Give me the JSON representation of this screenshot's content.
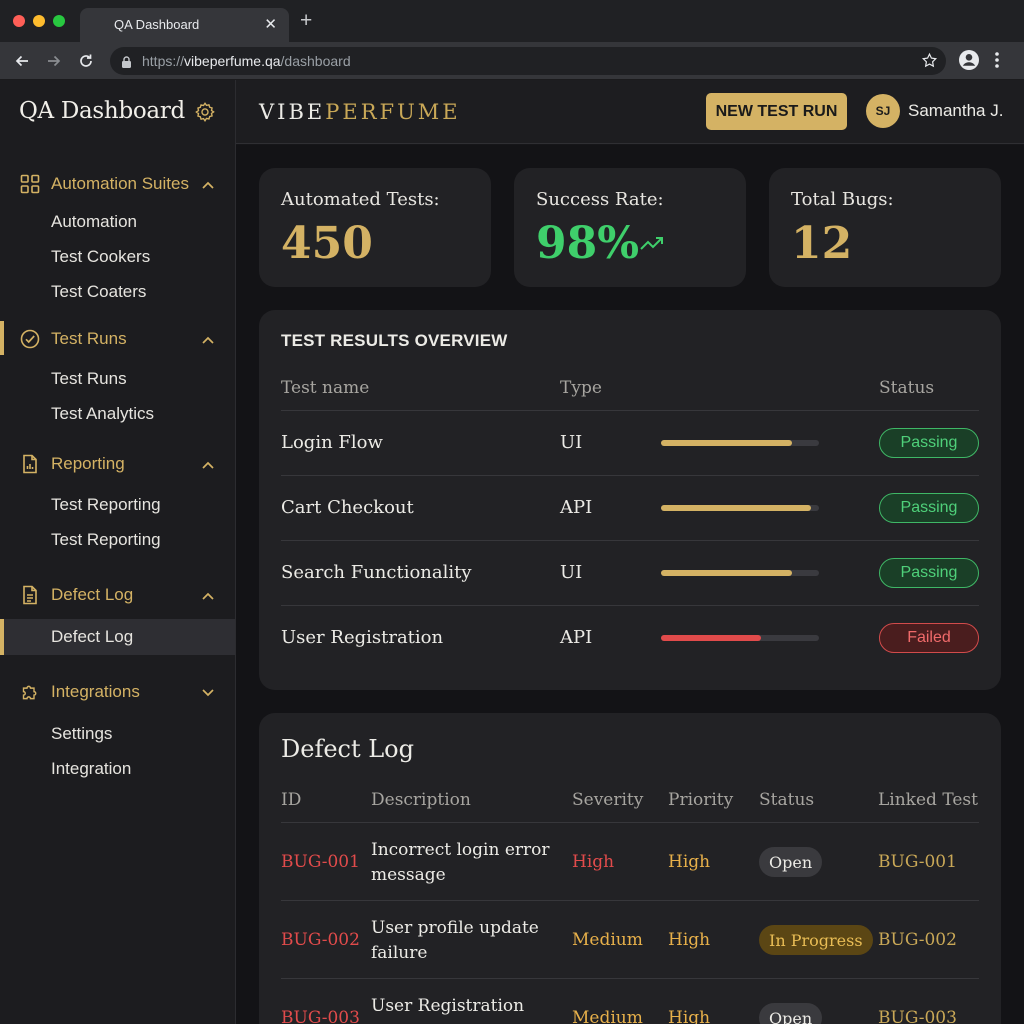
{
  "browser": {
    "tab_title": "QA Dashboard",
    "url_prefix": "https://",
    "url_host": "vibeperfume.qa",
    "url_path": "/dashboard",
    "traffic_lights": [
      "#ff5f57",
      "#febc2e",
      "#28c840"
    ]
  },
  "colors": {
    "accent": "#d4b264",
    "success": "#3fcf6b",
    "danger": "#e14b4b",
    "warning": "#e7b04a"
  },
  "sidebar": {
    "title": "QA Dashboard",
    "groups": [
      {
        "label": "Automation Suites",
        "icon": "grid-icon",
        "expanded": true,
        "items": [
          "Automation",
          "Test Cookers",
          "Test Coaters"
        ]
      },
      {
        "label": "Test Runs",
        "icon": "check-circle-icon",
        "expanded": true,
        "active": true,
        "items": [
          "Test Runs",
          "Test Analytics"
        ]
      },
      {
        "label": "Reporting",
        "icon": "report-icon",
        "expanded": true,
        "items": [
          "Test Reporting",
          "Test Reporting"
        ]
      },
      {
        "label": "Defect Log",
        "icon": "document-icon",
        "expanded": true,
        "items": [
          "Defect Log"
        ],
        "active_item": "Defect Log"
      },
      {
        "label": "Integrations",
        "icon": "puzzle-icon",
        "expanded": false,
        "items": [
          "Settings",
          "Integration"
        ]
      }
    ]
  },
  "header": {
    "logo_part1": "VIBE",
    "logo_part2": "PERFUME",
    "new_run_label": "NEW TEST RUN",
    "user_initials": "SJ",
    "user_name": "Samantha J."
  },
  "stats": [
    {
      "label": "Automated Tests:",
      "value": "450",
      "color": "#d4b264"
    },
    {
      "label": "Success Rate:",
      "value": "98%",
      "color": "#3fcf6b",
      "trend": "trending-up-icon"
    },
    {
      "label": "Total Bugs:",
      "value": "12",
      "color": "#d4b264"
    }
  ],
  "overview": {
    "title": "TEST RESULTS OVERVIEW",
    "columns": [
      "Test name",
      "Type",
      "Status"
    ],
    "rows": [
      {
        "name": "Login Flow",
        "type": "UI",
        "progress": 0.83,
        "bar_color": "#d4b264",
        "status": "Passing"
      },
      {
        "name": "Cart Checkout",
        "type": "API",
        "progress": 0.95,
        "bar_color": "#d4b264",
        "status": "Passing"
      },
      {
        "name": "Search Functionality",
        "type": "UI",
        "progress": 0.83,
        "bar_color": "#d4b264",
        "status": "Passing"
      },
      {
        "name": "User Registration",
        "type": "API",
        "progress": 0.63,
        "bar_color": "#e14b4b",
        "status": "Failed"
      }
    ]
  },
  "defect_log": {
    "title": "Defect Log",
    "columns": [
      "ID",
      "Description",
      "Severity",
      "Priority",
      "Status",
      "Linked Test"
    ],
    "rows": [
      {
        "id": "BUG-001",
        "desc1": "Incorrect login error",
        "desc2": "message",
        "severity": "High",
        "priority": "High",
        "status": "Open",
        "linked": "BUG-001"
      },
      {
        "id": "BUG-002",
        "desc1": "User profile update",
        "desc2": "failure",
        "severity": "Medium",
        "priority": "High",
        "status": "In Progress",
        "linked": "BUG-002"
      },
      {
        "id": "BUG-003",
        "desc1": "User Registration",
        "desc2": "",
        "severity": "Medium",
        "priority": "High",
        "status": "Open",
        "linked": "BUG-003"
      }
    ]
  }
}
